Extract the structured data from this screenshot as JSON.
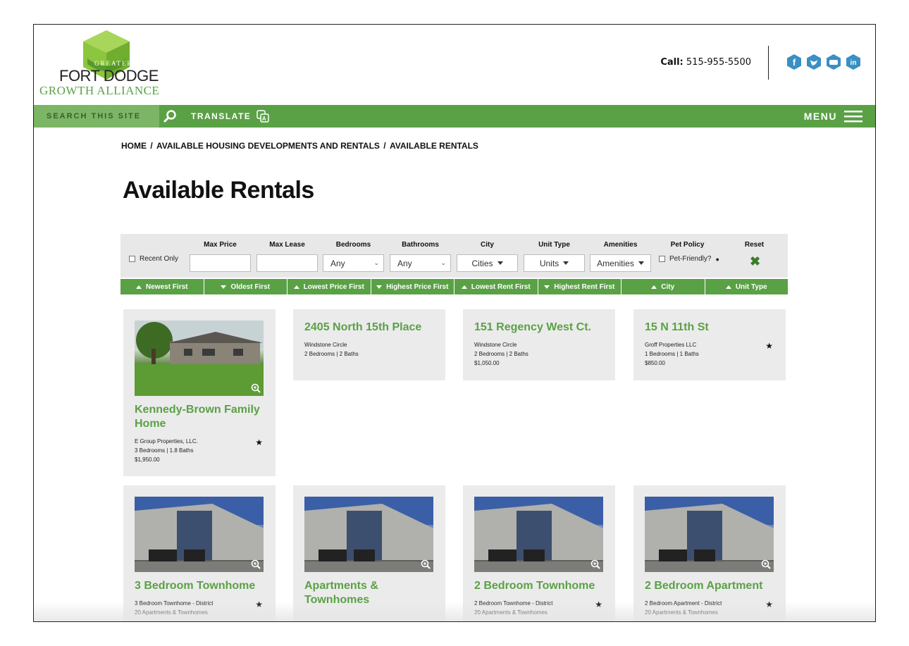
{
  "logo": {
    "line1": "GREATER",
    "line2": "FORT DODGE",
    "line3": "GROWTH ALLIANCE"
  },
  "header": {
    "call_label": "Call:",
    "phone": "515-955-5500"
  },
  "socials": [
    "facebook-icon",
    "twitter-icon",
    "youtube-icon",
    "linkedin-icon"
  ],
  "nav": {
    "search_placeholder": "SEARCH THIS SITE",
    "translate": "TRANSLATE",
    "menu": "MENU"
  },
  "breadcrumb": [
    "HOME",
    "AVAILABLE HOUSING DEVELOPMENTS AND RENTALS",
    "AVAILABLE RENTALS"
  ],
  "page_title": "Available Rentals",
  "filters": {
    "recent_only": "Recent Only",
    "max_price": "Max Price",
    "max_lease": "Max Lease",
    "bedrooms": {
      "label": "Bedrooms",
      "value": "Any"
    },
    "bathrooms": {
      "label": "Bathrooms",
      "value": "Any"
    },
    "city": {
      "label": "City",
      "value": "Cities"
    },
    "unit_type": {
      "label": "Unit Type",
      "value": "Units"
    },
    "amenities": {
      "label": "Amenities",
      "value": "Amenities"
    },
    "pet_policy": {
      "label": "Pet Policy",
      "value": "Pet-Friendly?"
    },
    "reset": "Reset"
  },
  "sort": [
    {
      "label": "Newest First",
      "dir": "up"
    },
    {
      "label": "Oldest First",
      "dir": "down"
    },
    {
      "label": "Lowest Price First",
      "dir": "up"
    },
    {
      "label": "Highest Price First",
      "dir": "down"
    },
    {
      "label": "Lowest Rent First",
      "dir": "up"
    },
    {
      "label": "Highest Rent First",
      "dir": "down"
    },
    {
      "label": "City",
      "dir": "up"
    },
    {
      "label": "Unit Type",
      "dir": "up"
    }
  ],
  "listings": [
    {
      "title": "Kennedy-Brown Family Home",
      "line1": "E Group Properties, LLC.",
      "line2": "3 Bedrooms | 1.8 Baths",
      "line3": "$1,950.00"
    },
    {
      "title": "2405 North 15th Place",
      "line1": "Windstone Circle",
      "line2": "2 Bedrooms | 2 Baths",
      "line3": ""
    },
    {
      "title": "151 Regency West Ct.",
      "line1": "Windstone Circle",
      "line2": "2 Bedrooms | 2 Baths",
      "line3": "$1,050.00"
    },
    {
      "title": "15 N 11th St",
      "line1": "Groff Properties LLC",
      "line2": "1 Bedrooms | 1 Baths",
      "line3": "$850.00"
    },
    {
      "title": "3 Bedroom Townhome",
      "line1": "3 Bedroom Townhome - District",
      "line2": "20 Apartments & Townhomes",
      "line3": ""
    },
    {
      "title": "Apartments & Townhomes",
      "line1": "",
      "line2": "",
      "line3": ""
    },
    {
      "title": "2 Bedroom Townhome",
      "line1": "2 Bedroom Townhome - District",
      "line2": "20 Apartments & Townhomes",
      "line3": ""
    },
    {
      "title": "2 Bedroom Apartment",
      "line1": "2 Bedroom Apartment - District",
      "line2": "20 Apartments & Townhomes",
      "line3": ""
    }
  ]
}
